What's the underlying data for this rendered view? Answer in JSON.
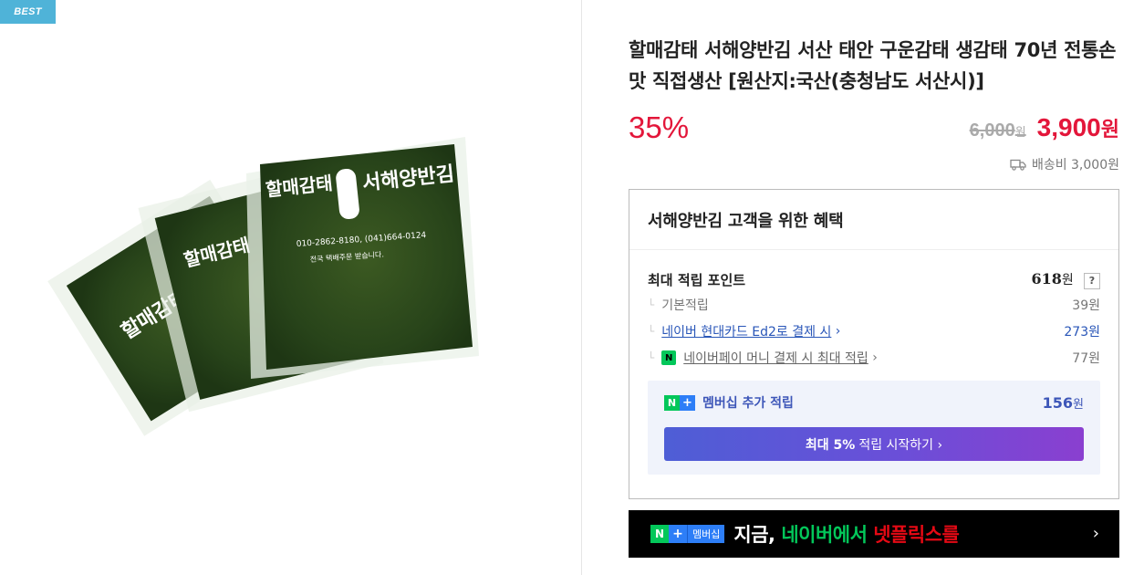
{
  "badge": "BEST",
  "product": {
    "title": "할매감태 서해양반김 서산 태안 구운감태 생감태 70년 전통손맛 직접생산 [원산지:국산(충청남도 서산시)]",
    "discount": "35%",
    "original_price": "6,000",
    "original_won": "원",
    "sale_price": "3,900",
    "sale_won": "원",
    "shipping": "배송비 3,000원",
    "package_text": {
      "brand": "할매감태",
      "shop": "서해양반김",
      "phone": "010-2862-8180, (041)664-0124",
      "delivery": "전국 택배주문 받습니다."
    }
  },
  "benefit": {
    "title": "서해양반김 고객을 위한 혜택",
    "max_points_label": "최대 적립 포인트",
    "max_points": "618",
    "won": "원",
    "help": "?",
    "rows": [
      {
        "label": "기본적립",
        "value": "39원"
      },
      {
        "label": "네이버 현대카드 Ed2로 결제 시",
        "value": "273원"
      },
      {
        "label": "네이버페이 머니 결제 시 최대 적립",
        "value": "77원"
      }
    ],
    "membership_label": "멤버십 추가 적립",
    "membership_amount": "156",
    "start_button_bold": "최대 5%",
    "start_button_text": "적립 시작하기 ›"
  },
  "banner": {
    "badge_n": "N",
    "badge_plus": "+",
    "badge_text": "멤버십",
    "text_1": "지금, ",
    "text_2": "네이버에서 ",
    "text_3": "넷플릭스를",
    "arrow": "›"
  },
  "colors": {
    "accent_red": "#e3163a",
    "link_blue": "#2956b8",
    "naver_green": "#03c75a",
    "badge_blue": "#4fb3d8"
  }
}
